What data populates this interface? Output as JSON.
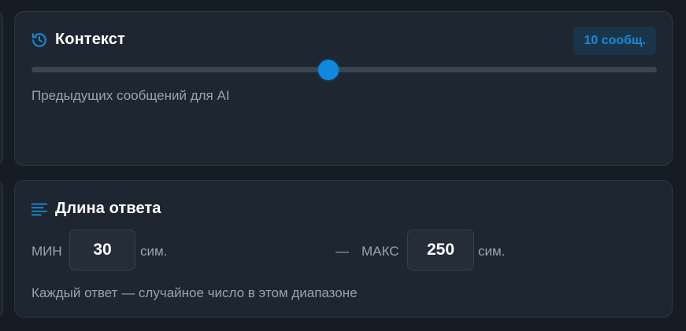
{
  "context": {
    "title": "Контекст",
    "badge": "10 сообщ.",
    "slider_fraction": 0.475,
    "hint": "Предыдущих сообщений для AI",
    "icon": "history-icon"
  },
  "length": {
    "title": "Длина ответа",
    "icon": "align-left-icon",
    "min_label": "МИН",
    "min_value": "30",
    "unit": "сим.",
    "dash": "—",
    "max_label": "МАКС",
    "max_value": "250",
    "hint": "Каждый ответ — случайное число в этом диапазоне"
  },
  "colors": {
    "accent": "#0d8ae0",
    "background": "#151c24",
    "card": "#1e2731",
    "muted_text": "#9aa3ad"
  }
}
